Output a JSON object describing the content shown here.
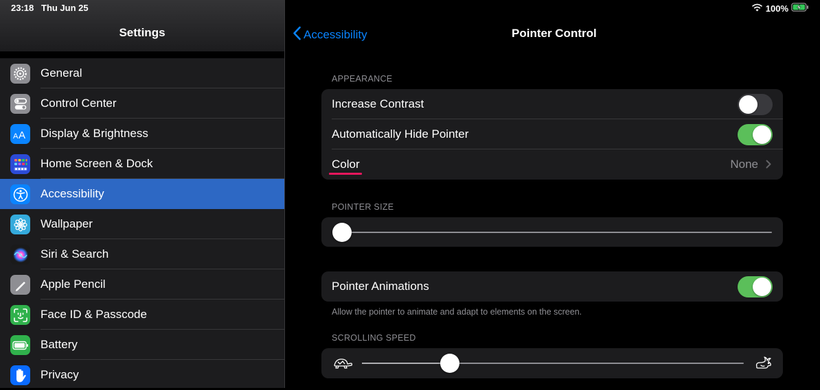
{
  "status": {
    "time": "23:18",
    "date": "Thu Jun 25",
    "battery": "100%"
  },
  "sidebar": {
    "title": "Settings",
    "items": [
      {
        "label": "General",
        "icon": "gear-icon",
        "color": "#8e8e93"
      },
      {
        "label": "Control Center",
        "icon": "toggles-icon",
        "color": "#8e8e93"
      },
      {
        "label": "Display & Brightness",
        "icon": "text-size-icon",
        "color": "#0a84ff"
      },
      {
        "label": "Home Screen & Dock",
        "icon": "home-grid-icon",
        "color": "#2c4bd6"
      },
      {
        "label": "Accessibility",
        "icon": "accessibility-icon",
        "color": "#0a84ff",
        "selected": true
      },
      {
        "label": "Wallpaper",
        "icon": "flower-icon",
        "color": "#34aadc"
      },
      {
        "label": "Siri & Search",
        "icon": "siri-icon",
        "color": "#222222"
      },
      {
        "label": "Apple Pencil",
        "icon": "pencil-icon",
        "color": "#8e8e93"
      },
      {
        "label": "Face ID & Passcode",
        "icon": "face-id-icon",
        "color": "#30b14c"
      },
      {
        "label": "Battery",
        "icon": "battery-icon",
        "color": "#30b14c"
      },
      {
        "label": "Privacy",
        "icon": "hand-icon",
        "color": "#0a6bff"
      }
    ]
  },
  "detail": {
    "back_label": "Accessibility",
    "title": "Pointer Control",
    "appearance_header": "APPEARANCE",
    "increase_contrast": {
      "label": "Increase Contrast",
      "on": false
    },
    "auto_hide": {
      "label": "Automatically Hide Pointer",
      "on": true
    },
    "color": {
      "label": "Color",
      "value": "None"
    },
    "pointer_size_header": "POINTER SIZE",
    "pointer_size_value": 0.0,
    "pointer_animations": {
      "label": "Pointer Animations",
      "on": true
    },
    "animations_footnote": "Allow the pointer to animate and adapt to elements on the screen.",
    "scrolling_speed_header": "SCROLLING SPEED",
    "scrolling_speed_value": 0.23
  },
  "colors": {
    "accent": "#0a84ff",
    "toggle_on": "#5bbf5a",
    "selection": "#2d68c4",
    "highlight_underline": "#e8175d"
  }
}
